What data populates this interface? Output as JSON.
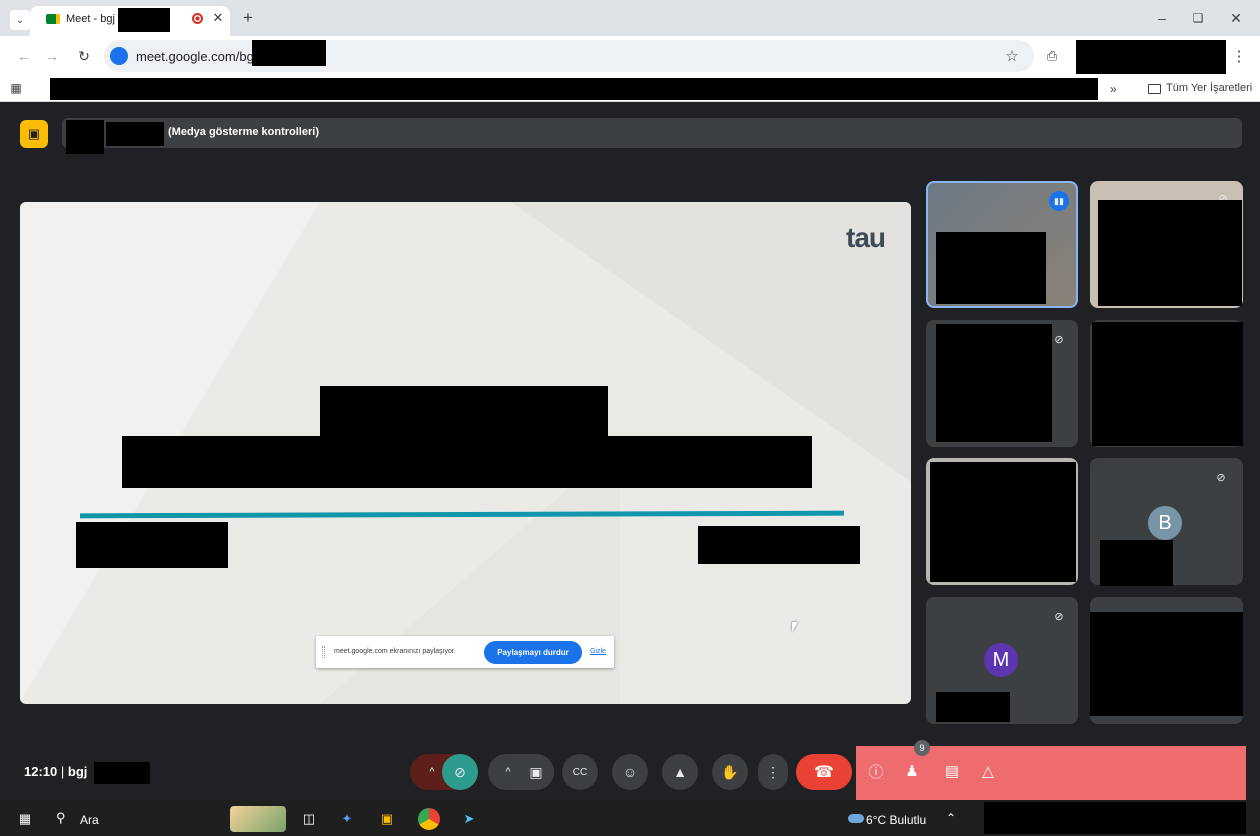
{
  "browser": {
    "tab_title": "Meet - bgj",
    "url": "meet.google.com/bgj",
    "bookmarks_more": "»",
    "all_bookmarks": "Tüm Yer İşaretleri"
  },
  "meet": {
    "presentation_label": "(Medya gösterme kontrolleri)",
    "slide_logo": "tau",
    "share_notice": "meet.google.com ekranınızı paylaşıyor.",
    "stop_share": "Paylaşmayı durdur",
    "hide": "Gizle",
    "participants": [
      {
        "initial": "B",
        "color": "#7895a6"
      },
      {
        "initial": "M",
        "color": "#5e35b1"
      }
    ],
    "clock": "12:10",
    "meeting_code": "bgj",
    "participants_count": "9"
  },
  "taskbar": {
    "search": "Ara",
    "weather": "6°C Bulutlu"
  }
}
